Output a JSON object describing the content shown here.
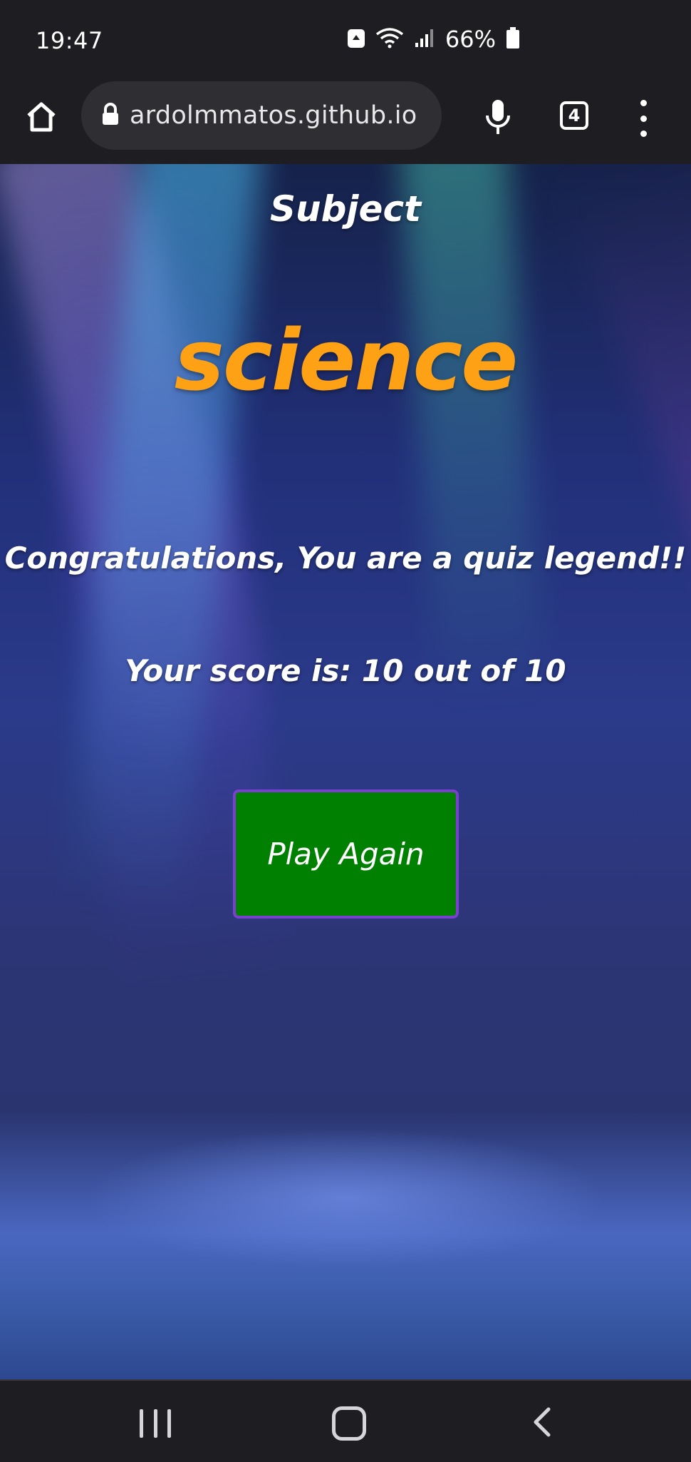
{
  "status_bar": {
    "time": "19:47",
    "battery": "66%",
    "icons": [
      "recycle-notification-icon",
      "wifi-icon",
      "signal-icon",
      "battery-icon"
    ]
  },
  "browser": {
    "url": "ardolmmatos.github.io",
    "tab_count": "4",
    "icons": [
      "home-icon",
      "lock-icon",
      "mic-icon",
      "tabs-icon",
      "more-vert-icon"
    ]
  },
  "quiz": {
    "subject_label": "Subject",
    "subject_name": "science",
    "message": "Congratulations, You are a quiz legend!!",
    "score_text": "Your score is: 10 out of 10",
    "play_again_label": "Play Again"
  },
  "colors": {
    "subject_name": "#ffa115",
    "button_bg": "#008000",
    "button_border": "#7a3fd0"
  },
  "nav_bar": {
    "icons": [
      "recents-icon",
      "home-icon",
      "back-icon"
    ]
  }
}
